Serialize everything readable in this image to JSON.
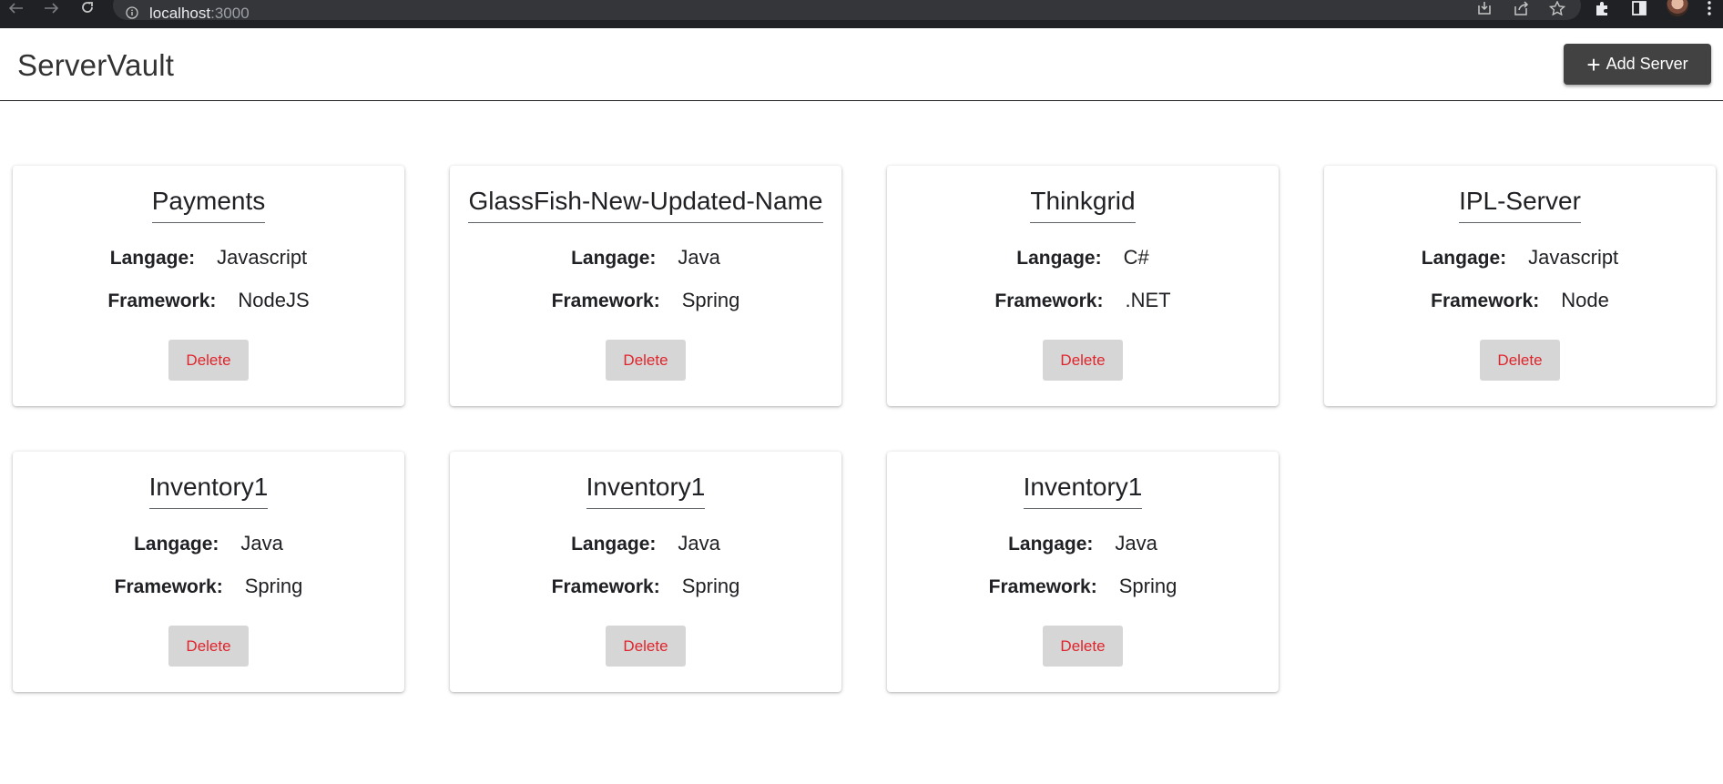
{
  "browser": {
    "url_host": "localhost",
    "url_port": ":3000"
  },
  "header": {
    "title": "ServerVault",
    "add_button_label": "Add Server"
  },
  "labels": {
    "language": "Langage:",
    "framework": "Framework:",
    "delete": "Delete"
  },
  "servers": [
    {
      "name": "Payments",
      "language": "Javascript",
      "framework": "NodeJS"
    },
    {
      "name": "GlassFish-New-Updated-Name",
      "language": "Java",
      "framework": "Spring"
    },
    {
      "name": "Thinkgrid",
      "language": "C#",
      "framework": ".NET"
    },
    {
      "name": "IPL-Server",
      "language": "Javascript",
      "framework": "Node"
    },
    {
      "name": "Inventory1",
      "language": "Java",
      "framework": "Spring"
    },
    {
      "name": "Inventory1",
      "language": "Java",
      "framework": "Spring"
    },
    {
      "name": "Inventory1",
      "language": "Java",
      "framework": "Spring"
    }
  ],
  "colors": {
    "header_button_bg": "#424242",
    "delete_bg": "#d6d6d6",
    "delete_text": "#e0242b",
    "browser_bar": "#202124"
  }
}
